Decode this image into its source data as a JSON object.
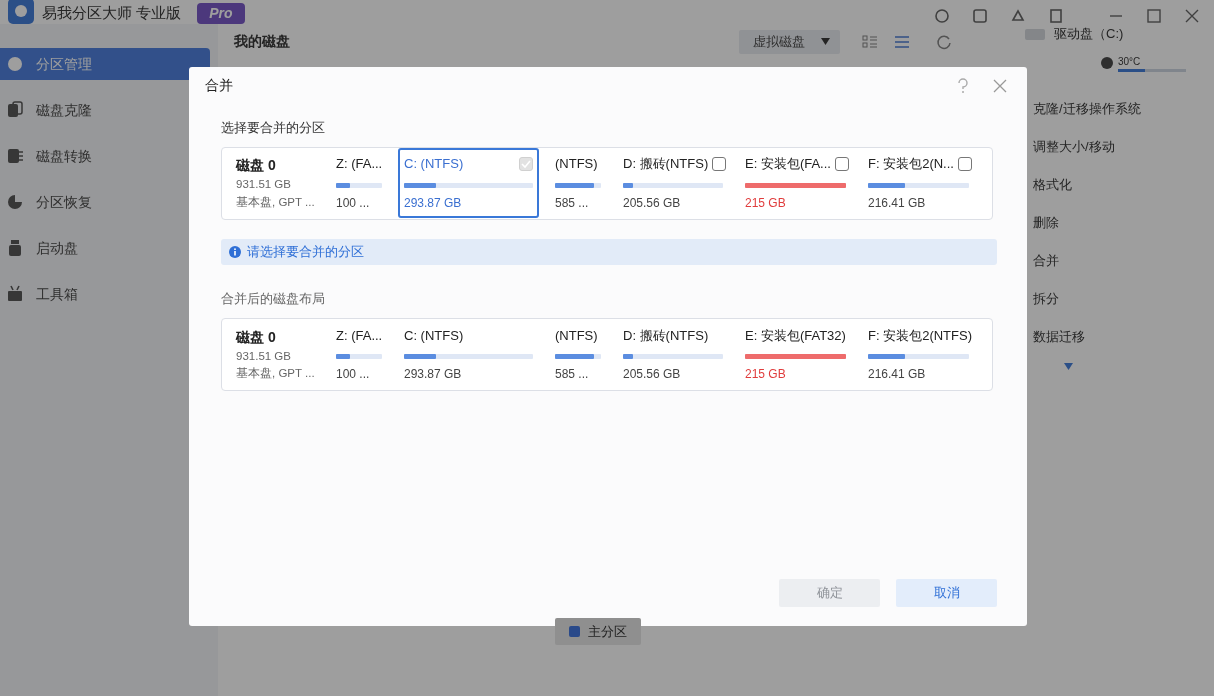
{
  "app": {
    "title": "易我分区大师 专业版",
    "badge": "Pro"
  },
  "sidebar": {
    "items": [
      {
        "label": "分区管理",
        "selected": true,
        "kind": "pie"
      },
      {
        "label": "磁盘克隆",
        "selected": false,
        "kind": "clone"
      },
      {
        "label": "磁盘转换",
        "selected": false,
        "kind": "convert"
      },
      {
        "label": "分区恢复",
        "selected": false,
        "kind": "recover"
      },
      {
        "label": "启动盘",
        "selected": false,
        "kind": "usb"
      },
      {
        "label": "工具箱",
        "selected": false,
        "kind": "toolbox"
      }
    ]
  },
  "main": {
    "title": "我的磁盘",
    "virtual_disk_button": "虚拟磁盘",
    "view_buttons": [
      {
        "kind": "grid",
        "selected": false
      },
      {
        "kind": "list",
        "selected": true
      }
    ]
  },
  "right_panel": {
    "drive": "驱动盘（C:)",
    "temperature": {
      "reading": "30°C",
      "level": 0.4
    },
    "actions": [
      "克隆/迁移操作系统",
      "调整大小/移动",
      "格式化",
      "删除",
      "合并",
      "拆分",
      "数据迁移"
    ]
  },
  "legend": {
    "label": "主分区",
    "color": "#2a4a8a"
  },
  "dialog": {
    "title": "合并",
    "section_label": "选择要合并的分区",
    "disk": {
      "name": "磁盘 0",
      "size": "931.51 GB",
      "type": "基本盘, GPT ..."
    },
    "partitions": [
      {
        "label": "Z: (FA...",
        "size": "100 ...",
        "level": 0.3,
        "kind": "plain",
        "selected": false,
        "warning": false
      },
      {
        "label": "C: (NTFS)",
        "size": "293.87 GB",
        "level": 0.25,
        "kind": "option",
        "selected": true,
        "checked": true,
        "disabled": true,
        "warning": false
      },
      {
        "label": "(NTFS)",
        "size": "585 ...",
        "level": 0.85,
        "kind": "plain",
        "selected": false,
        "warning": false
      },
      {
        "label": "D: 搬砖(NTFS)",
        "size": "205.56 GB",
        "level": 0.1,
        "kind": "option",
        "selected": false,
        "checked": false,
        "warning": false
      },
      {
        "label": "E: 安装包(FA...",
        "size": "215 GB",
        "level": 1,
        "kind": "option",
        "selected": false,
        "checked": false,
        "warning": true
      },
      {
        "label": "F: 安装包2(N...",
        "size": "216.41 GB",
        "level": 0.37,
        "kind": "option",
        "selected": false,
        "checked": false,
        "warning": false
      }
    ],
    "info": "请选择要合并的分区",
    "result_label": "合并后的磁盘布局",
    "result_disk": {
      "name": "磁盘 0",
      "size": "931.51 GB",
      "type": "基本盘, GPT ..."
    },
    "result_partitions": [
      {
        "label": "Z: (FA...",
        "size": "100 ...",
        "level": 0.3,
        "warning": false
      },
      {
        "label": "C: (NTFS)",
        "size": "293.87 GB",
        "level": 0.25,
        "warning": false
      },
      {
        "label": "(NTFS)",
        "size": "585 ...",
        "level": 0.85,
        "warning": false
      },
      {
        "label": "D: 搬砖(NTFS)",
        "size": "205.56 GB",
        "level": 0.1,
        "warning": false
      },
      {
        "label": "E: 安装包(FAT32)",
        "size": "215 GB",
        "level": 1,
        "warning": true
      },
      {
        "label": "F: 安装包2(NTFS)",
        "size": "216.41 GB",
        "level": 0.37,
        "warning": false
      }
    ],
    "buttons": [
      {
        "label": "确定",
        "disabled": true
      },
      {
        "label": "取消",
        "disabled": false
      }
    ]
  }
}
